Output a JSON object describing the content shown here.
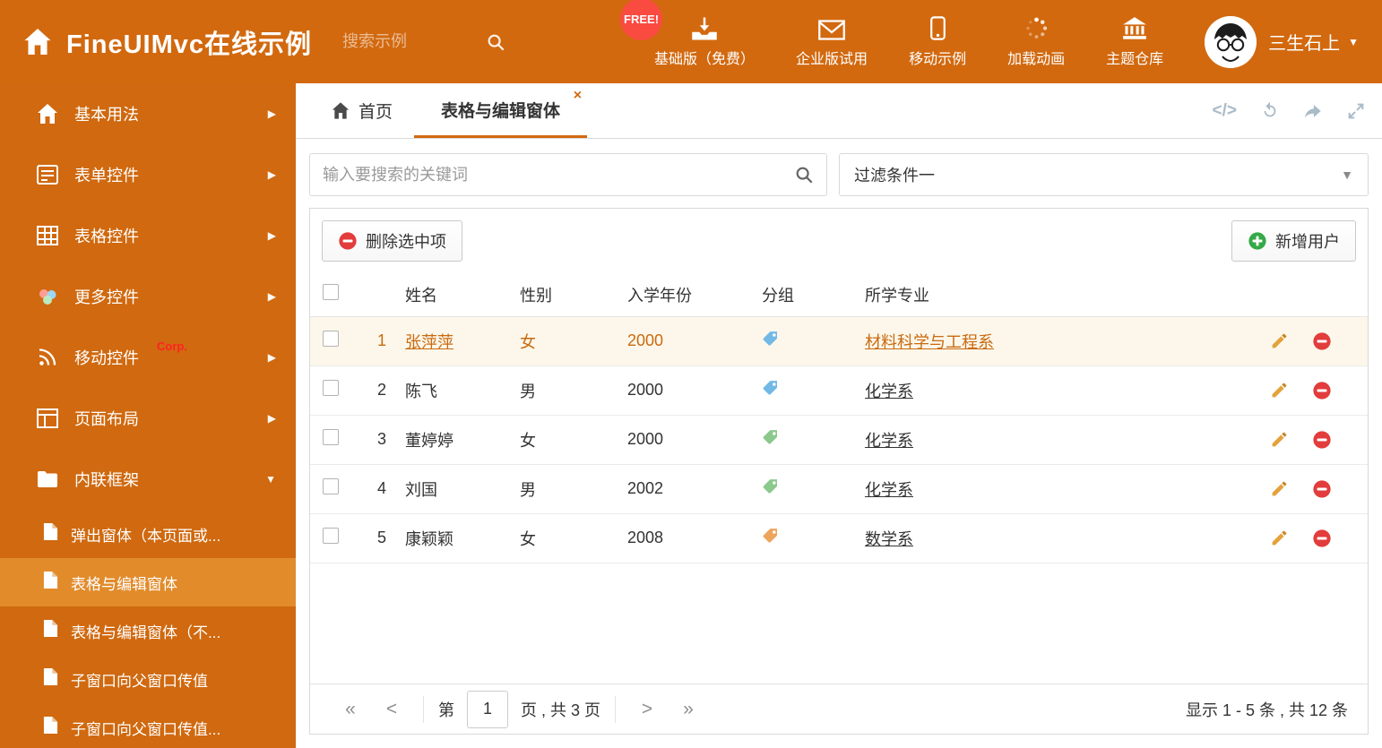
{
  "header": {
    "title": "FineUIMvc在线示例",
    "search_placeholder": "搜索示例",
    "free_badge": "FREE!",
    "nav": [
      {
        "label": "基础版（免费）"
      },
      {
        "label": "企业版试用"
      },
      {
        "label": "移动示例"
      },
      {
        "label": "加载动画"
      },
      {
        "label": "主题仓库"
      }
    ],
    "user_name": "三生石上"
  },
  "sidebar": {
    "items": [
      {
        "label": "基本用法"
      },
      {
        "label": "表单控件"
      },
      {
        "label": "表格控件"
      },
      {
        "label": "更多控件"
      },
      {
        "label": "移动控件",
        "badge": "Corp."
      },
      {
        "label": "页面布局"
      },
      {
        "label": "内联框架"
      }
    ],
    "subitems": [
      {
        "label": "弹出窗体（本页面或..."
      },
      {
        "label": "表格与编辑窗体"
      },
      {
        "label": "表格与编辑窗体（不..."
      },
      {
        "label": "子窗口向父窗口传值"
      },
      {
        "label": "子窗口向父窗口传值..."
      }
    ]
  },
  "tabs": {
    "home_label": "首页",
    "active_label": "表格与编辑窗体"
  },
  "filter": {
    "search_placeholder": "输入要搜索的关键词",
    "selected_filter": "过滤条件一"
  },
  "toolbar": {
    "delete_label": "删除选中项",
    "add_label": "新增用户"
  },
  "table": {
    "headers": {
      "name": "姓名",
      "gender": "性别",
      "year": "入学年份",
      "group": "分组",
      "major": "所学专业"
    },
    "rows": [
      {
        "num": "1",
        "name": "张萍萍",
        "gender": "女",
        "year": "2000",
        "tag_color": "#72b9e6",
        "major": "材料科学与工程系"
      },
      {
        "num": "2",
        "name": "陈飞",
        "gender": "男",
        "year": "2000",
        "tag_color": "#72b9e6",
        "major": "化学系"
      },
      {
        "num": "3",
        "name": "董婷婷",
        "gender": "女",
        "year": "2000",
        "tag_color": "#8cc98c",
        "major": "化学系"
      },
      {
        "num": "4",
        "name": "刘国",
        "gender": "男",
        "year": "2002",
        "tag_color": "#8cc98c",
        "major": "化学系"
      },
      {
        "num": "5",
        "name": "康颖颖",
        "gender": "女",
        "year": "2008",
        "tag_color": "#eda55d",
        "major": "数学系"
      }
    ]
  },
  "pagination": {
    "page_prefix": "第",
    "page_value": "1",
    "page_suffix": "页 , 共 3 页",
    "summary": "显示 1 - 5 条 , 共 12 条"
  },
  "icons": {
    "caret_down": "▼",
    "arrow_right": "▶",
    "close": "×",
    "code": "</>",
    "first": "«",
    "prev": "<",
    "next": ">",
    "last": "»"
  },
  "colors": {
    "accent": "#d2690f",
    "sidebar_active": "#e28b2b",
    "row_highlight": "#fcf7ea",
    "danger": "#e23c3c",
    "success": "#35a948"
  }
}
